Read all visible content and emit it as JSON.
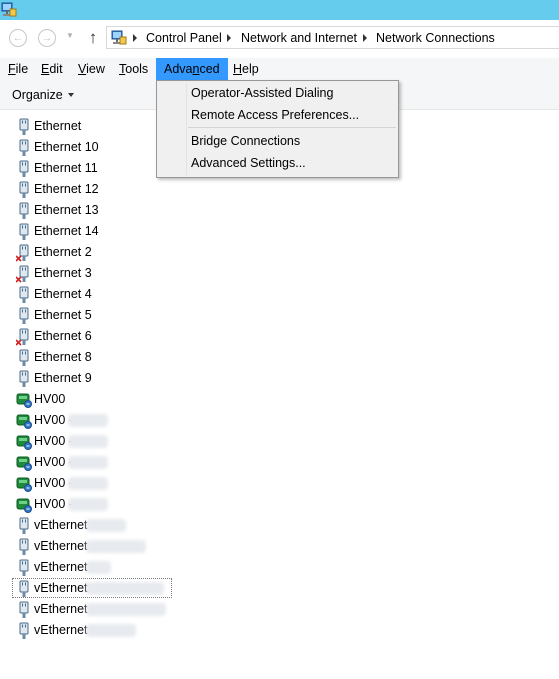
{
  "address_bar": {
    "breadcrumbs": [
      "Control Panel",
      "Network and Internet",
      "Network Connections"
    ]
  },
  "menubar": {
    "items": [
      {
        "label": "File",
        "access_key": "F"
      },
      {
        "label": "Edit",
        "access_key": "E"
      },
      {
        "label": "View",
        "access_key": "V"
      },
      {
        "label": "Tools",
        "access_key": "T"
      },
      {
        "label": "Advanced",
        "access_key": "n",
        "active": true
      },
      {
        "label": "Help",
        "access_key": "H"
      }
    ]
  },
  "command_bar": {
    "organize_label": "Organize"
  },
  "advanced_menu": {
    "items": [
      "Operator-Assisted Dialing",
      "Remote Access Preferences...",
      "Bridge Connections",
      "Advanced Settings..."
    ]
  },
  "connections": [
    {
      "name": "Ethernet",
      "icon": "ethernet-icon"
    },
    {
      "name": "Ethernet 10",
      "icon": "ethernet-icon"
    },
    {
      "name": "Ethernet 11",
      "icon": "ethernet-icon"
    },
    {
      "name": "Ethernet 12",
      "icon": "ethernet-icon"
    },
    {
      "name": "Ethernet 13",
      "icon": "ethernet-icon"
    },
    {
      "name": "Ethernet 14",
      "icon": "ethernet-icon"
    },
    {
      "name": "Ethernet 2",
      "icon": "ethernet-disconnected-icon"
    },
    {
      "name": "Ethernet 3",
      "icon": "ethernet-disconnected-icon"
    },
    {
      "name": "Ethernet 4",
      "icon": "ethernet-icon"
    },
    {
      "name": "Ethernet 5",
      "icon": "ethernet-icon"
    },
    {
      "name": "Ethernet 6",
      "icon": "ethernet-disconnected-icon"
    },
    {
      "name": "Ethernet 8",
      "icon": "ethernet-icon"
    },
    {
      "name": "Ethernet 9",
      "icon": "ethernet-icon"
    },
    {
      "name": "HV00",
      "icon": "team-adapter-icon"
    },
    {
      "name": "HV00 -",
      "icon": "team-adapter-icon"
    },
    {
      "name": "HV00 -",
      "icon": "team-adapter-icon"
    },
    {
      "name": "HV00 -",
      "icon": "team-adapter-icon"
    },
    {
      "name": "HV00 -",
      "icon": "team-adapter-icon"
    },
    {
      "name": "HV00 -",
      "icon": "team-adapter-icon"
    },
    {
      "name": "vEthernet",
      "icon": "ethernet-icon"
    },
    {
      "name": "vEthernet",
      "icon": "ethernet-icon"
    },
    {
      "name": "vEthernet",
      "icon": "ethernet-icon"
    },
    {
      "name": "vEthernet",
      "icon": "ethernet-icon",
      "selected": true
    },
    {
      "name": "vEthernet",
      "icon": "ethernet-icon"
    },
    {
      "name": "vEthernet",
      "icon": "ethernet-icon"
    }
  ],
  "colors": {
    "titlebar": "#65ccee",
    "menu_active": "#3399ff",
    "menubar_bg": "#f5f6f7",
    "dropdown_bg": "#f0f0f0"
  }
}
